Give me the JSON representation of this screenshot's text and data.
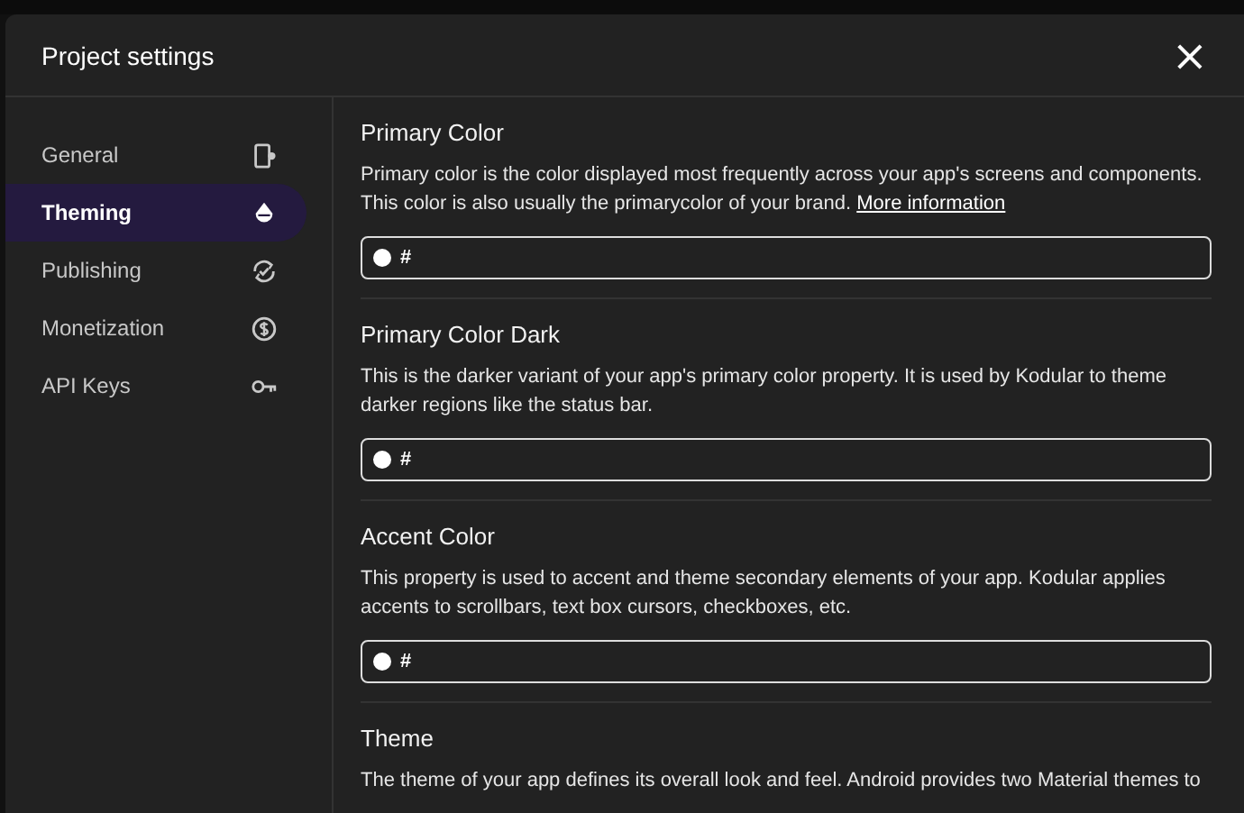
{
  "dialog": {
    "title": "Project settings",
    "close": "×"
  },
  "sidebar": {
    "items": [
      {
        "label": "General",
        "selected": false
      },
      {
        "label": "Theming",
        "selected": true
      },
      {
        "label": "Publishing",
        "selected": false
      },
      {
        "label": "Monetization",
        "selected": false
      },
      {
        "label": "API Keys",
        "selected": false
      }
    ]
  },
  "sections": [
    {
      "title": "Primary Color",
      "description": "Primary color is the color displayed most frequently across your app's screens and components. This color is also usually the primarycolor of your brand.",
      "link": "More information",
      "value": "#"
    },
    {
      "title": "Primary Color Dark",
      "description": "This is the darker variant of your app's primary color property. It is used by Kodular to theme darker regions like the status bar.",
      "value": "#"
    },
    {
      "title": "Accent Color",
      "description": "This property is used to accent and theme secondary elements of your app. Kodular applies accents to scrollbars, text box cursors, checkboxes, etc.",
      "value": "#"
    },
    {
      "title": "Theme",
      "description": "The theme of your app defines its overall look and feel. Android provides two Material themes to"
    }
  ]
}
